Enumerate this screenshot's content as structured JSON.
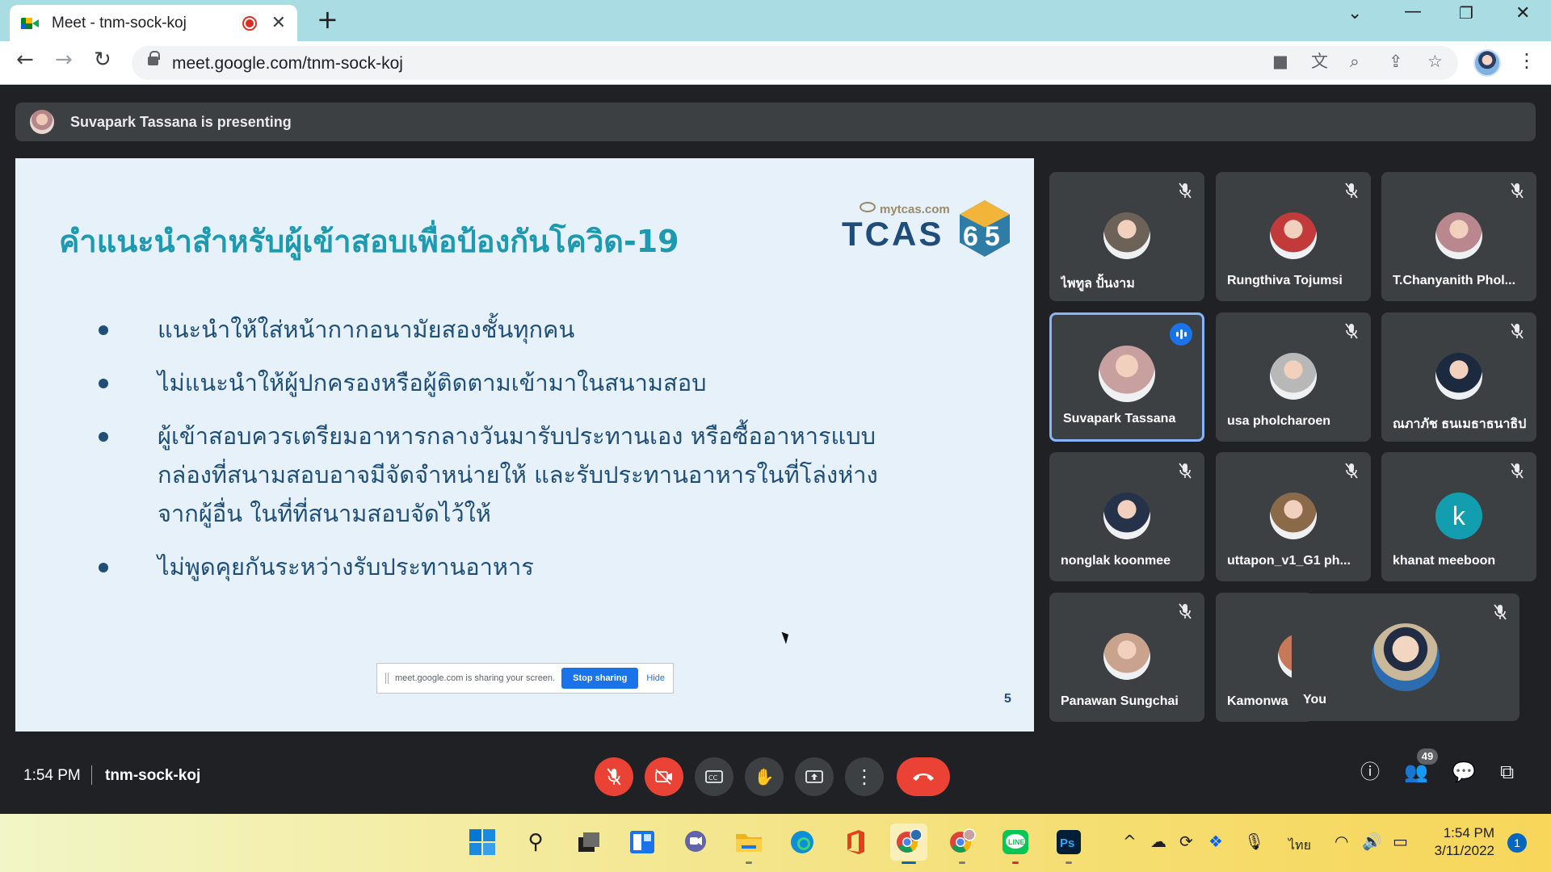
{
  "browser": {
    "tab_title": "Meet - tnm-sock-koj",
    "new_tab_symbol": "+",
    "url": "meet.google.com/tnm-sock-koj"
  },
  "presenting_banner": {
    "text": "Suvapark Tassana is presenting"
  },
  "slide": {
    "title": "คำแนะนำสำหรับผู้เข้าสอบเพื่อป้องกันโควิด-19",
    "logo_site": "mytcas.com",
    "logo_word": "TCAS",
    "logo_number": "65",
    "bullets": [
      "แนะนำให้ใส่หน้ากากอนามัยสองชั้นทุกคน",
      "ไม่แนะนำให้ผู้ปกครองหรือผู้ติดตามเข้ามาในสนามสอบ",
      "ผู้เข้าสอบควรเตรียมอาหารกลางวันมารับประทานเอง หรือซื้ออาหารแบบกล่องที่สนามสอบอาจมีจัดจำหน่ายให้ และรับประทานอาหารในที่โล่งห่างจากผู้อื่น ในที่ที่สนามสอบจัดไว้ให้",
      "ไม่พูดคุยกันระหว่างรับประทานอาหาร"
    ],
    "page_number": "5",
    "share_bar": {
      "message": "meet.google.com is sharing your screen.",
      "stop_label": "Stop sharing",
      "hide_label": "Hide"
    }
  },
  "participants": [
    {
      "name": "ไพทูล ปั้นงาม",
      "avatar_color": "#6d6257"
    },
    {
      "name": "Rungthiva Tojumsi",
      "avatar_color": "#c23a3a"
    },
    {
      "name": "T.Chanyanith Phol...",
      "avatar_color": "#b9888e"
    },
    {
      "name": "Suvapark Tassana",
      "avatar_color": "#c9a0a0"
    },
    {
      "name": "usa pholcharoen",
      "avatar_color": "#b8b8b8"
    },
    {
      "name": "ณภาภัช ธนเมธาธนาธิป",
      "avatar_color": "#1c2a40"
    },
    {
      "name": "nonglak koonmee",
      "avatar_color": "#25324a"
    },
    {
      "name": "uttapon_v1_G1 ph...",
      "avatar_color": "#8a6a48"
    },
    {
      "name": "khanat meeboon",
      "avatar_color": "#129eaf",
      "letter": "k"
    },
    {
      "name": "Panawan Sungchai",
      "avatar_color": "#c9a38e"
    },
    {
      "name": "Kamonwa",
      "avatar_color": "#c77a5a"
    }
  ],
  "self_tile": {
    "name": "You",
    "avatar_color": "#2c6db0"
  },
  "meet_bar": {
    "time": "1:54 PM",
    "meeting_code": "tnm-sock-koj",
    "people_count": "49"
  },
  "taskbar": {
    "language": "ไทย",
    "time": "1:54 PM",
    "date": "3/11/2022",
    "notification_count": "1"
  }
}
